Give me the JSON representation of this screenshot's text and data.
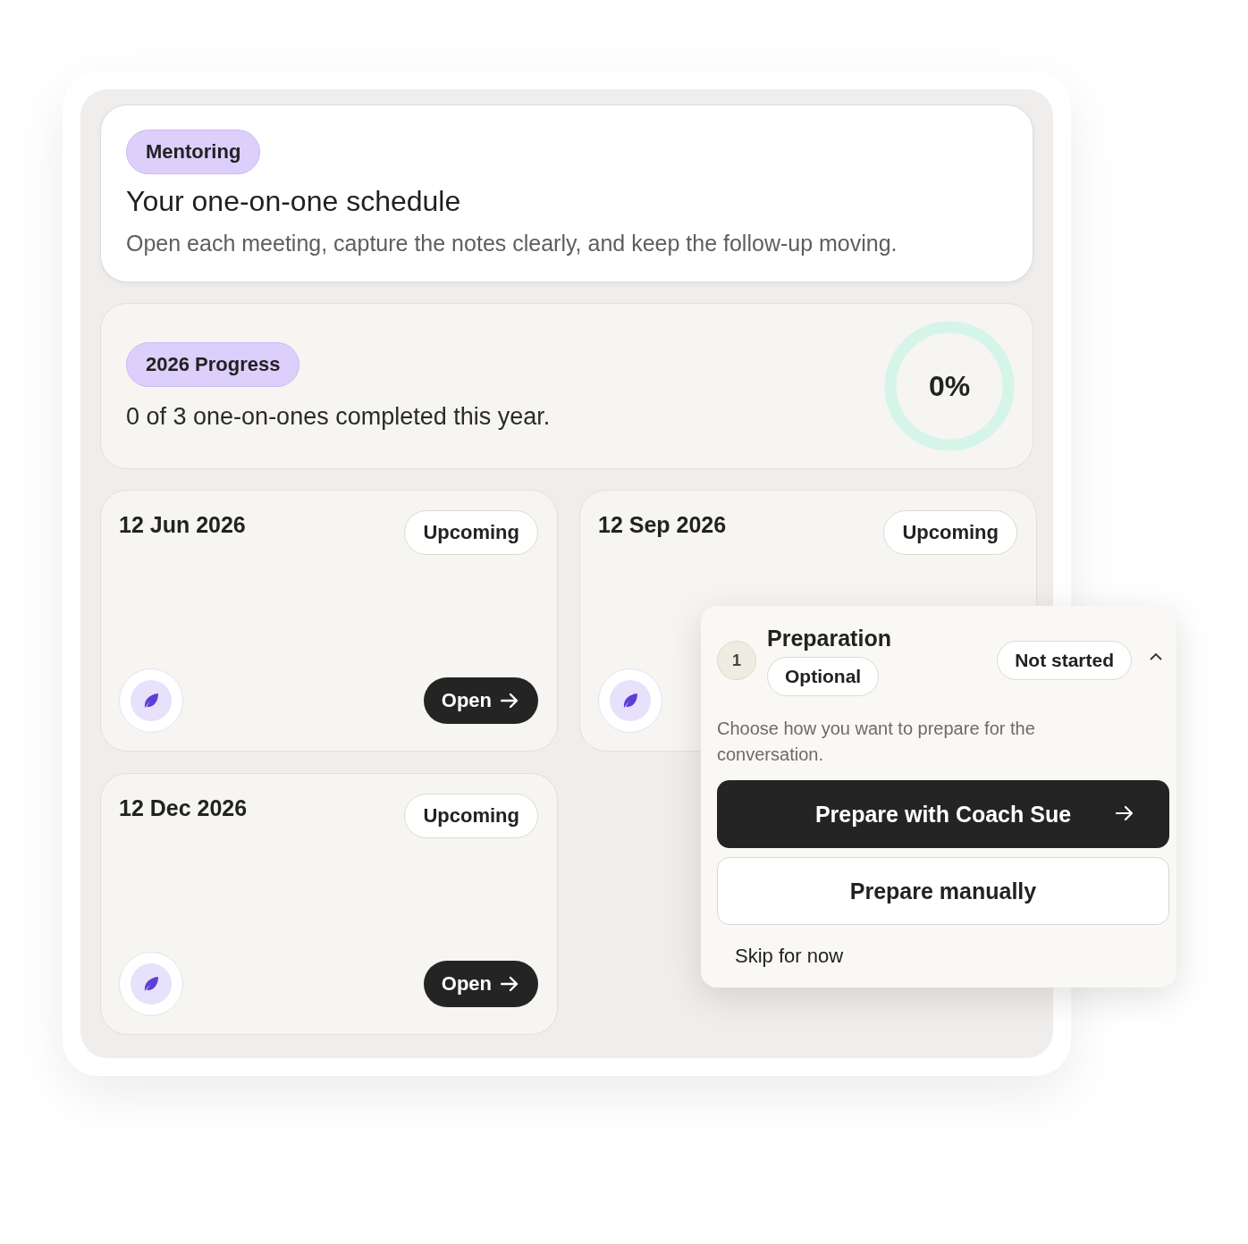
{
  "header": {
    "tag": "Mentoring",
    "title": "Your one-on-one schedule",
    "description": "Open each meeting, capture the notes clearly, and keep the follow-up moving."
  },
  "progress": {
    "tag": "2026 Progress",
    "summary": "0 of 3 one-on-ones completed this year.",
    "reading": "0%"
  },
  "meetings": [
    {
      "date": "12 Jun 2026",
      "status": "Upcoming",
      "open_label": "Open"
    },
    {
      "date": "12 Sep 2026",
      "status": "Upcoming"
    },
    {
      "date": "12 Dec 2026",
      "status": "Upcoming",
      "open_label": "Open"
    }
  ],
  "preparation": {
    "step": "1",
    "title": "Preparation",
    "tag": "Optional",
    "status": "Not started",
    "expanded": true,
    "description": "Choose how you want to prepare for the conversation.",
    "primary_action": "Prepare with Coach Sue",
    "secondary_action": "Prepare manually",
    "skip_action": "Skip for now"
  }
}
